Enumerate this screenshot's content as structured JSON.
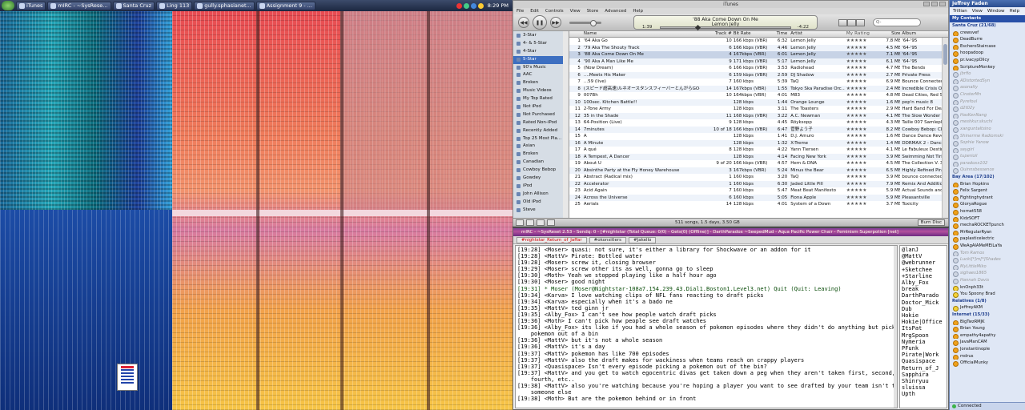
{
  "taskbar": {
    "tasks": [
      "iTunes",
      "mIRC - ~SysRese...",
      "Santa Cruz",
      "Ling 113",
      "gully.sphasianet...",
      "Assignment 9 - ..."
    ],
    "clock": "8:29 PM"
  },
  "itunes": {
    "title": "iTunes",
    "menu": [
      "File",
      "Edit",
      "Controls",
      "View",
      "Store",
      "Advanced",
      "Help"
    ],
    "now_playing": {
      "track": "'88 Aka Come Down On Me",
      "artist": "Lemon Jelly",
      "elapsed": "1:39",
      "remaining": "-4:22",
      "progress": 0.27
    },
    "search_placeholder": "Q-",
    "sources": [
      "3-Star",
      "4- & 5-Star",
      "4-Star",
      "5-Star",
      "90's Music",
      "AAC",
      "Broken",
      "Music Videos",
      "My Top Rated",
      "Not iPod",
      "Not Purchased",
      "Rated Non-iPod",
      "Recently Added",
      "Top 25 Most Pla...",
      "Asian",
      "Broken",
      "Canadian",
      "Cowboy Bebop",
      "Gowdey",
      "iPod",
      "John Allison",
      "Old iPod",
      "Steve"
    ],
    "selected_source": "5-Star",
    "columns": [
      "",
      "Name",
      "Track #",
      "Bit Rate",
      "Time",
      "Artist",
      "My Rating",
      "Size",
      "Album"
    ],
    "rows": [
      [
        "1",
        "'64 Aka Go",
        "10",
        "166 kbps (VBR)",
        "6:32",
        "Lemon Jelly",
        "★★★★★",
        "7.8 MB",
        "'64-'95"
      ],
      [
        "2",
        "'79 Aka The Shouty Track",
        "6",
        "166 kbps (VBR)",
        "4:46",
        "Lemon Jelly",
        "★★★★★",
        "4.5 MB",
        "'64-'95"
      ],
      [
        "3",
        "'88 Aka Come Down On Me",
        "4",
        "167kbps (VBR)",
        "6:01",
        "Lemon Jelly",
        "★★★★★",
        "7.1 MB",
        "'64-'95"
      ],
      [
        "4",
        "'90 Aka A Man Like Me",
        "9",
        "171 kbps (VBR)",
        "5:17",
        "Lemon Jelly",
        "★★★★★",
        "6.1 MB",
        "'64-'95"
      ],
      [
        "5",
        "(Now Dream)",
        "6",
        "166 kbps (VBR)",
        "3:53",
        "Radiohead",
        "★★★★★",
        "4.7 MB",
        "The Bends"
      ],
      [
        "6",
        "....Meets His Maker",
        "6",
        "159 kbps (VBR)",
        "2:59",
        "DJ Shadow",
        "★★★★★",
        "2.7 MB",
        "Private Press"
      ],
      [
        "7",
        "...59 (live)",
        "7",
        "160 kbps",
        "5:39",
        "TaQ",
        "★★★★★",
        "6.9 MB",
        "Bounce Connected"
      ],
      [
        "8",
        "(スピード超高速)ルネオースタンスフィーバーとんがらGO-GO",
        "14",
        "167kbps (VBR)",
        "1:55",
        "Tokyo Ska Paradise Orc...",
        "★★★★★",
        "2.4 MB",
        "Incredible Crisis Origi..."
      ],
      [
        "9",
        "007Bh",
        "10",
        "164kbps (VBR)",
        "4:01",
        "M83",
        "★★★★★",
        "4.8 MB",
        "Dead Cities, Red Seas..."
      ],
      [
        "10",
        "100sec. Kitchen Battle!!",
        "",
        "128 kbps",
        "1:44",
        "Orange Lounge",
        "★★★★★",
        "1.6 MB",
        "pop'n music 8"
      ],
      [
        "11",
        "2-Tone Army",
        "",
        "128 kbps",
        "3:11",
        "The Toasters",
        "★★★★★",
        "2.9 MB",
        "Hard Band For Dead"
      ],
      [
        "12",
        "35 in the Shade",
        "11",
        "168 kbps (VBR)",
        "3:22",
        "A.C. Newman",
        "★★★★★",
        "4.1 MB",
        "The Slow Wonder"
      ],
      [
        "13",
        "64-Position (Live)",
        "9",
        "128 kbps",
        "4:45",
        "Röyksopp",
        "★★★★★",
        "4.3 MB",
        "Taille 007 Samlepl..."
      ],
      [
        "14",
        "7minutes",
        "10 of 18",
        "166 kbps (VBR)",
        "6:47",
        "菅野よう子",
        "★★★★★",
        "8.2 MB",
        "Cowboy Bebop: CD-B..."
      ],
      [
        "15",
        "A",
        "",
        "128 kbps",
        "1:41",
        "D.J. Amuro",
        "★★★★★",
        "1.6 MB",
        "Dance Dance Revolu..."
      ],
      [
        "16",
        "A Minute",
        "",
        "128 kbps",
        "1:32",
        "X-Treme",
        "★★★★★",
        "1.4 MB",
        "DDRMAX 2 - Dance D..."
      ],
      [
        "17",
        "A qué",
        "8",
        "128 kbps",
        "4:22",
        "Yann Tiersen",
        "★★★★★",
        "4.1 MB",
        "Le Fabuleux Destin d..."
      ],
      [
        "18",
        "A Tempest, A Dancer",
        "",
        "128 kbps",
        "4:14",
        "Facing New York",
        "★★★★★",
        "3.9 MB",
        "Swimming Not Tiring"
      ],
      [
        "19",
        "About U",
        "9 of 20",
        "166 kbps (VBR)",
        "4:57",
        "Hem & DNA",
        "★★★★★",
        "4.5 MB",
        "The Collection V. 3"
      ],
      [
        "20",
        "Absinthe Party at the Fly Honey Warehouse",
        "3",
        "167kbps (VBR)",
        "5:24",
        "Minus the Bear",
        "★★★★★",
        "6.5 MB",
        "Highly Refined Pirates"
      ],
      [
        "21",
        "Abstract (Radical mix)",
        "1",
        "160 kbps",
        "3:20",
        "TaQ",
        "★★★★★",
        "3.9 MB",
        "bounce connected"
      ],
      [
        "22",
        "Accelerator",
        "1",
        "160 kbps",
        "6:30",
        "Jaded Little Pill",
        "★★★★★",
        "7.9 MB",
        "Remix And Additional..."
      ],
      [
        "23",
        "Acid Again",
        "7",
        "160 kbps",
        "5:47",
        "Meat Beat Manifesto",
        "★★★★★",
        "5.9 MB",
        "Actual Sounds and Voi..."
      ],
      [
        "24",
        "Across the Universe",
        "6",
        "160 kbps",
        "5:05",
        "Fiona Apple",
        "★★★★★",
        "5.9 MB",
        "Pleasantville"
      ],
      [
        "25",
        "Aerials",
        "14",
        "128 kbps",
        "4:01",
        "System of a Down",
        "★★★★★",
        "3.7 MB",
        "Toxicity"
      ]
    ],
    "current_row": 2,
    "status_summary": "511 songs, 1.5 days, 3.50 GB",
    "burn_label": "Burn Disc"
  },
  "mirc": {
    "title": "mIRC - ~SysReset 2.53 - Sendq: 0 - [#nightstar (Total Queue: 0/0) - Gets(0) (Offline)] - DarthParadox ~SeepedMud - Aqua Pacific Power Chair - Feminism Superpotion [net]",
    "tabs": [
      {
        "label": "#nightstar_Return_of_Jaffar",
        "red": true
      },
      {
        "label": "#okonsitlers",
        "red": false
      },
      {
        "label": "#Jakello",
        "red": false
      }
    ],
    "lines": [
      {
        "t": "[19:28] <Moser> quasi: not sure, it's either a library for Shockwave or an addon for it",
        "quit": false
      },
      {
        "t": "[19:28] <MattV> Pirate: Bottled water",
        "quit": false
      },
      {
        "t": "[19:28] <Moser> screw it, closing browser",
        "quit": false
      },
      {
        "t": "[19:29] <Moser> screw other its as well, gonna go to sleep",
        "quit": false
      },
      {
        "t": "[19:30] <Moth> Yeah we stopped playing like a half hour ago",
        "quit": false
      },
      {
        "t": "[19:30] <Moser> good night",
        "quit": false
      },
      {
        "t": "[19:31] * Moser (Moser@Nightstar-108a7.154.239.43.Dial1.Boston1.Level3.net) Quit (Quit: Leaving)",
        "quit": true
      },
      {
        "t": "[19:34] <Karva> I love watching clips of NFL fans reacting to draft picks",
        "quit": false
      },
      {
        "t": "[19:34] <Karva> especially when it's a bado ne",
        "quit": false
      },
      {
        "t": "[19:35] <MattV> ted ginn jr",
        "quit": false
      },
      {
        "t": "[19:35] <Alby_Fox> I can't see how people watch draft picks",
        "quit": false
      },
      {
        "t": "[19:36] <Moth> I can't pick how people see draft watches",
        "quit": false
      },
      {
        "t": "[19:36] <Alby_Fox> its like if you had a whole season of pokemon episodes where they didn't do anything but pick",
        "quit": false
      },
      {
        "t": "pokemon out of a bin",
        "wrap": true
      },
      {
        "t": "[19:36] <MattV> but it's not a whole season",
        "quit": false
      },
      {
        "t": "[19:36] <MattV> it's a day",
        "quit": false
      },
      {
        "t": "[19:37] <MattV> pokemon has like 700 episodes",
        "quit": false
      },
      {
        "t": "[19:37] <MattV> also the draft makes for wackiness when teams reach on crappy players",
        "quit": false
      },
      {
        "t": "[19:37] <Quasispace> Isn't every episode picking a pokemon out of the bin?",
        "quit": false
      },
      {
        "t": "[19:37] <MattV> and you get to watch egocentric divas get taken down a peg when they aren't taken first, second, third,",
        "quit": false
      },
      {
        "t": "fourth, etc..",
        "wrap": true
      },
      {
        "t": "[19:38] <MattV> also you're watching because you're hoping a player you want to see drafted by your team isn't taken by",
        "quit": false
      },
      {
        "t": "someone else",
        "wrap": true
      },
      {
        "t": "[19:38] <Moth> But are the pokemon behind or in front",
        "quit": false
      }
    ],
    "nicks": [
      "@lanJ",
      "@MattV",
      "@webrunner",
      "+Sketchee",
      "+Starline",
      "Alby_Fox",
      "break",
      "DarthParado",
      "Doctor_Mick",
      "Dub",
      "Hokie",
      "Hokie|Office",
      "ItsPat",
      "MrgSpoon",
      "Nymeria",
      "PFunk",
      "Pirate|Work",
      "Quasispace",
      "Return_of_J",
      "Sapphira",
      "Shinryuu",
      "sluissa",
      "Upth"
    ]
  },
  "trillian": {
    "title": "Jeffrey Faden",
    "menu": [
      "Trillian",
      "View",
      "Window",
      "Help"
    ],
    "header": "My Contacts",
    "groups": [
      {
        "name": "Santa Cruz (21/68)",
        "contacts": [
          {
            "n": "crewsvef",
            "s": "on"
          },
          {
            "n": "DeadBurre",
            "s": "on"
          },
          {
            "n": "EscheroStaircase",
            "s": "on"
          },
          {
            "n": "hoopadoop",
            "s": "on"
          },
          {
            "n": "pr.ivacypOlicy",
            "s": "on"
          },
          {
            "n": "ScriptureMonkey",
            "s": "on"
          },
          {
            "n": "jbrfio",
            "s": "away"
          },
          {
            "n": "ADistortedSyn",
            "s": "away"
          },
          {
            "n": "asonalty",
            "s": "away"
          },
          {
            "n": "CinsterMn",
            "s": "away"
          },
          {
            "n": "Pyrefoul",
            "s": "away"
          },
          {
            "n": "d2t02y",
            "s": "away"
          },
          {
            "n": "HasKenNang",
            "s": "away"
          },
          {
            "n": "meshkur.skuchi",
            "s": "away"
          },
          {
            "n": "xanguntaltsino",
            "s": "away"
          },
          {
            "n": "Shinerrne Radiomski",
            "s": "away"
          },
          {
            "n": "Sophie Yanow",
            "s": "away"
          },
          {
            "n": "seygirl",
            "s": "away"
          },
          {
            "n": "tuperioil",
            "s": "away"
          },
          {
            "n": "paradoxx102",
            "s": "away"
          },
          {
            "n": "Quinnsbessence",
            "s": "away"
          }
        ]
      },
      {
        "name": "Bay Area (17/102)",
        "contacts": [
          {
            "n": "Brian Hopkins",
            "s": "on"
          },
          {
            "n": "Felix Sargent",
            "s": "on"
          },
          {
            "n": "Fightinghydrant",
            "s": "on"
          },
          {
            "n": "GloryaRogue",
            "s": "on"
          },
          {
            "n": "hornet558",
            "s": "on"
          },
          {
            "n": "KidzSOFT",
            "s": "on"
          },
          {
            "n": "mechaROCKETpunch",
            "s": "on"
          },
          {
            "n": "MrRegularRyan",
            "s": "on"
          },
          {
            "n": "paplasticelectric",
            "s": "on"
          },
          {
            "n": "WeAgAIAMeMEiLaYa",
            "s": "on"
          },
          {
            "n": "Tom Ramos",
            "s": "away"
          },
          {
            "n": "Lucki[*]m[*]Shades",
            "s": "away"
          },
          {
            "n": "MyLittleMiko",
            "s": "away"
          },
          {
            "n": "sighaes1865",
            "s": "away"
          },
          {
            "n": "Hannah Davis",
            "s": "away"
          },
          {
            "n": "knOnph33t",
            "s": "aim"
          },
          {
            "n": "You Spoony Brad",
            "s": "aim"
          }
        ]
      },
      {
        "name": "Relatives (1/8)",
        "contacts": [
          {
            "n": "JeffreyAKM",
            "s": "aim"
          }
        ]
      },
      {
        "name": "Internet (15/33)",
        "contacts": [
          {
            "n": "BigTwzRMJK",
            "s": "on"
          },
          {
            "n": "Brian Young",
            "s": "on"
          },
          {
            "n": "empathy4apathy",
            "s": "on"
          },
          {
            "n": "JavaManCAM",
            "s": "on"
          },
          {
            "n": "Jonstantinople",
            "s": "on"
          },
          {
            "n": "mdrus",
            "s": "on"
          },
          {
            "n": "OfficialMunky",
            "s": "on"
          }
        ]
      }
    ],
    "status": "Connected"
  }
}
